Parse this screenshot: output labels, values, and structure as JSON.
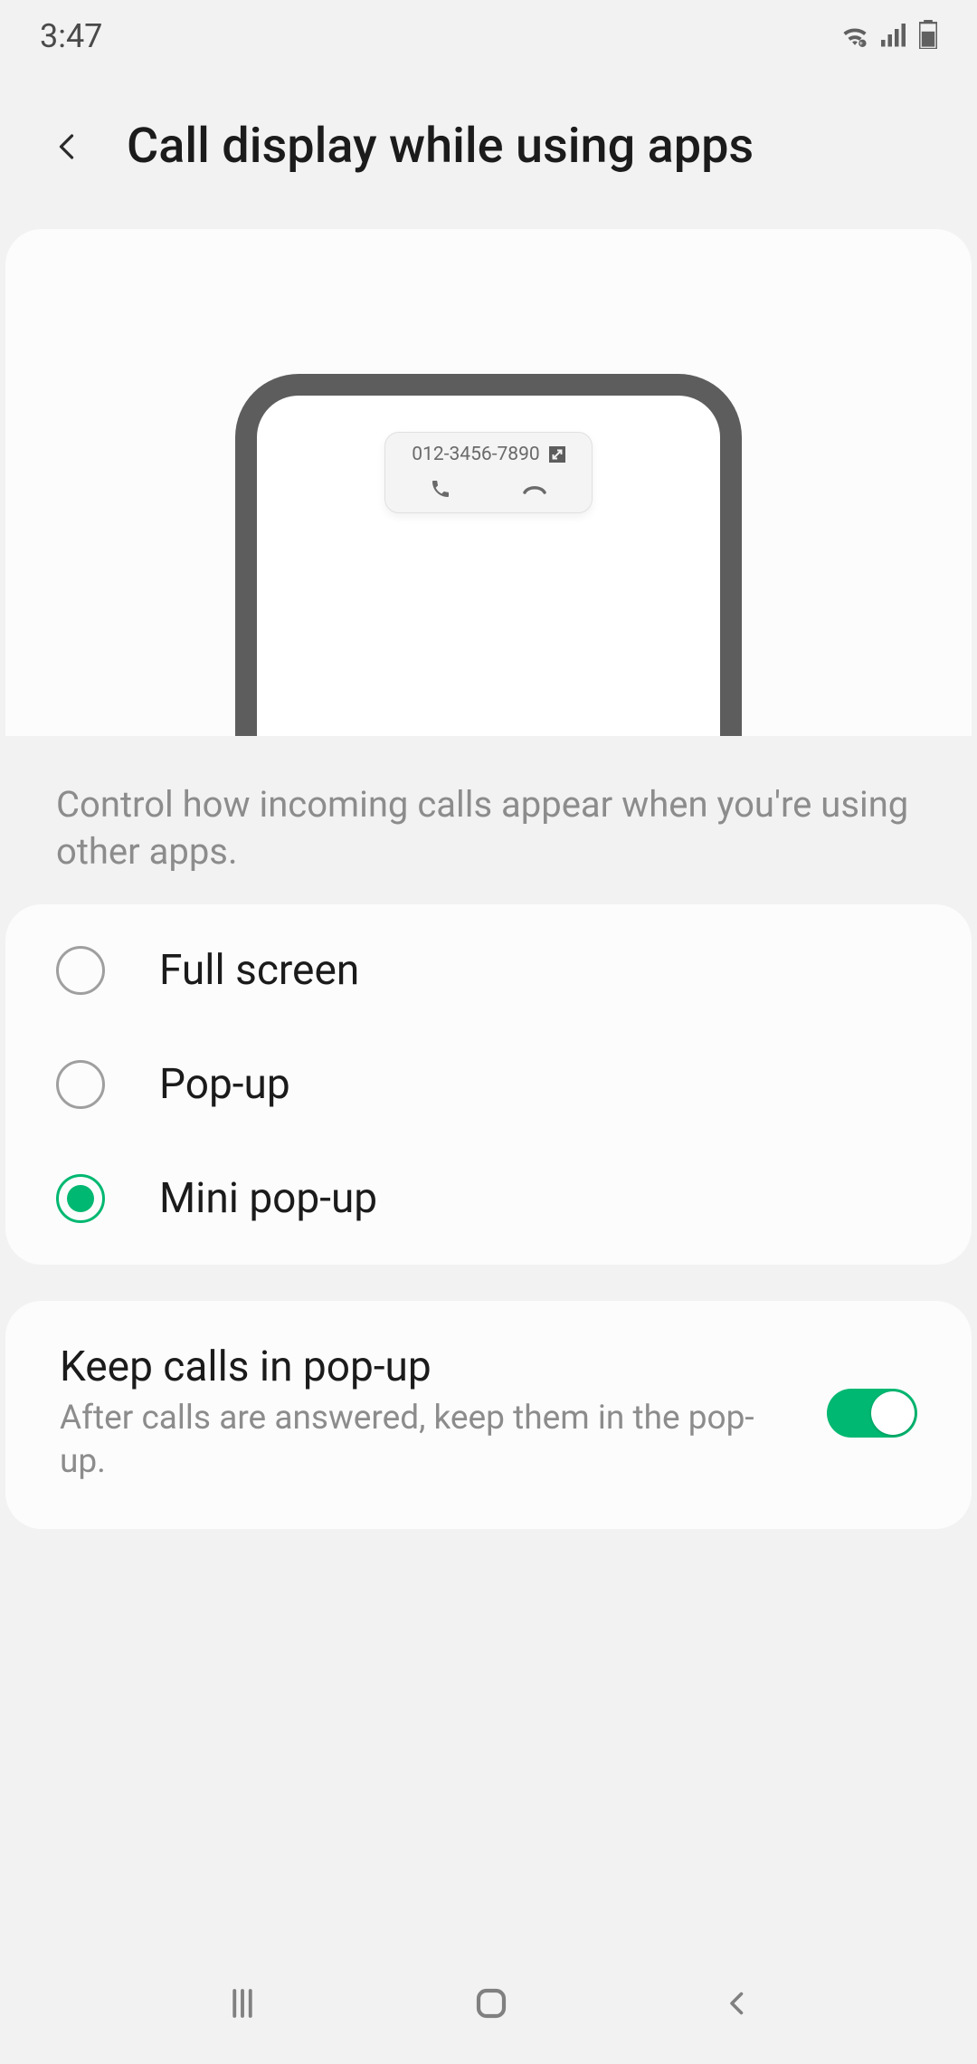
{
  "status": {
    "time": "3:47"
  },
  "header": {
    "title": "Call display while using apps"
  },
  "preview": {
    "phone_number": "012-3456-7890"
  },
  "description": "Control how incoming calls appear when you're using other apps.",
  "options": [
    {
      "label": "Full screen",
      "selected": false
    },
    {
      "label": "Pop-up",
      "selected": false
    },
    {
      "label": "Mini pop-up",
      "selected": true
    }
  ],
  "keep_in_popup": {
    "title": "Keep calls in pop-up",
    "subtitle": "After calls are answered, keep them in the pop-up.",
    "enabled": true
  }
}
